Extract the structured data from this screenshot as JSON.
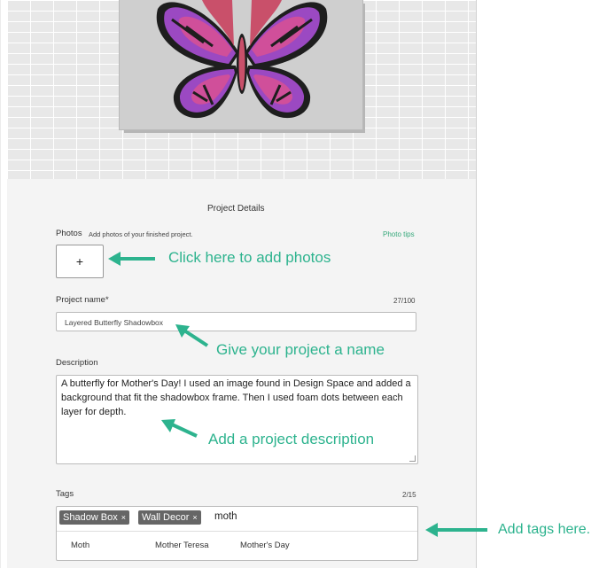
{
  "project_details": {
    "title": "Project Details",
    "photos": {
      "label": "Photos",
      "hint": "Add photos of your finished project.",
      "tips_link": "Photo tips",
      "add_button": "+"
    },
    "project_name": {
      "label": "Project name*",
      "counter": "27/100",
      "value": "Layered Butterfly Shadowbox"
    },
    "description": {
      "label": "Description",
      "value": "A butterfly for Mother's Day! I used an image found in Design Space and added a background that fit the shadowbox frame. Then I used foam dots between each layer for depth."
    },
    "tags": {
      "label": "Tags",
      "counter": "2/15",
      "chips": [
        {
          "label": "Shadow Box",
          "remove": "×"
        },
        {
          "label": "Wall Decor",
          "remove": "×"
        }
      ],
      "typed_value": "moth",
      "suggestions": [
        "Moth",
        "Mother Teresa",
        "Mother's Day"
      ]
    }
  },
  "annotations": {
    "photos": "Click here to add photos",
    "name": "Give your project a name",
    "description": "Add a project description",
    "tags": "Add tags here."
  },
  "colors": {
    "annotation": "#2db38e",
    "link": "#35a87a",
    "chip": "#666666",
    "butterfly_outer": "#9b49c2",
    "butterfly_inner": "#d04f9a",
    "butterfly_body": "#c9506a"
  }
}
